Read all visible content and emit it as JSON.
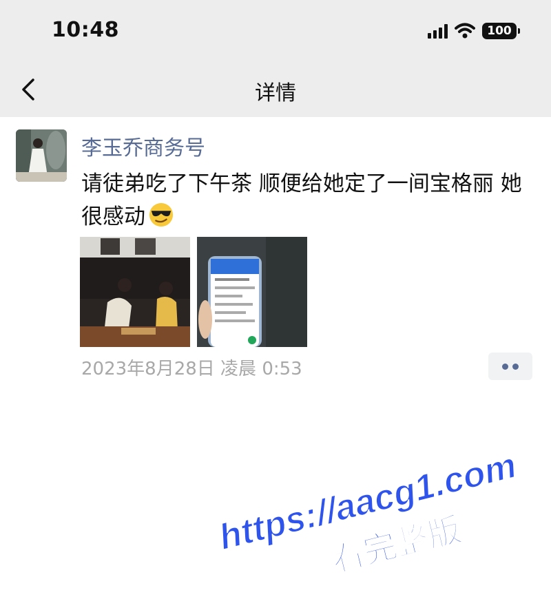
{
  "status_bar": {
    "time": "10:48",
    "battery": "100"
  },
  "nav": {
    "title": "详情"
  },
  "post": {
    "author": "李玉乔商务号",
    "text": "请徒弟吃了下午茶 顺便给她定了一间宝格丽 她很感动",
    "emoji": "sunglasses-smiley",
    "timestamp": "2023年8月28日 凌晨 0:53"
  },
  "watermark": {
    "line1": "https://aacg1.com",
    "line2": "看完整版"
  },
  "colors": {
    "author": "#576b95",
    "watermark": "#2f54eb",
    "nav_bg": "#ededed"
  }
}
